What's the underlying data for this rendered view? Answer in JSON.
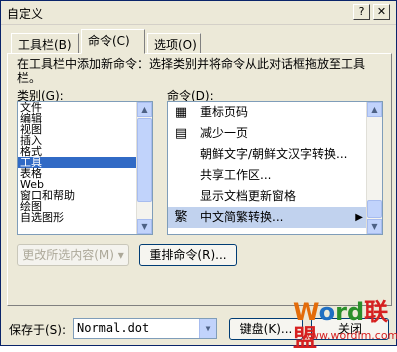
{
  "window": {
    "title": "自定义",
    "help_glyph": "?",
    "close_glyph": "✕"
  },
  "tabs": [
    {
      "label": "工具栏(B)",
      "active": false
    },
    {
      "label": "命令(C)",
      "active": true
    },
    {
      "label": "选项(O)",
      "active": false
    }
  ],
  "description": "在工具栏中添加新命令：选择类别并将命令从此对话框拖放至工具栏。",
  "categories": {
    "label": "类别(G):",
    "items": [
      "文件",
      "编辑",
      "视图",
      "插入",
      "格式",
      "工具",
      "表格",
      "Web",
      "窗口和帮助",
      "绘图",
      "自选图形"
    ],
    "selected": "工具"
  },
  "commands": {
    "label": "命令(D):",
    "items": [
      {
        "icon": "renumber-page-icon",
        "glyph": "▦",
        "label": "重标页码"
      },
      {
        "icon": "shrink-one-page-icon",
        "glyph": "▤",
        "label": "减少一页"
      },
      {
        "icon": "",
        "glyph": "",
        "label": "朝鲜文字/朝鲜文汉字转换..."
      },
      {
        "icon": "",
        "glyph": "",
        "label": "共享工作区..."
      },
      {
        "icon": "",
        "glyph": "",
        "label": "显示文档更新窗格"
      },
      {
        "icon": "traditional-char-icon",
        "glyph": "繁",
        "label": "中文简繁转换...",
        "has_submenu": true,
        "selected": true
      }
    ]
  },
  "buttons": {
    "modify_selection": "更改所选内容(M) ▾",
    "rearrange_commands": "重排命令(R)...",
    "keyboard": "键盘(K)...",
    "close": "关闭"
  },
  "save_in": {
    "label": "保存于(S):",
    "value": "Normal.dot"
  },
  "watermark": {
    "logo_w": "W",
    "logo_o": "o",
    "logo_rest": "rd",
    "logo_cn": "联盟",
    "url": "www.wordlm.com"
  },
  "colors": {
    "selection_blue": "#316ac5",
    "selected_command_bg": "#c1d2ee",
    "dialog_face": "#ece9d8"
  }
}
